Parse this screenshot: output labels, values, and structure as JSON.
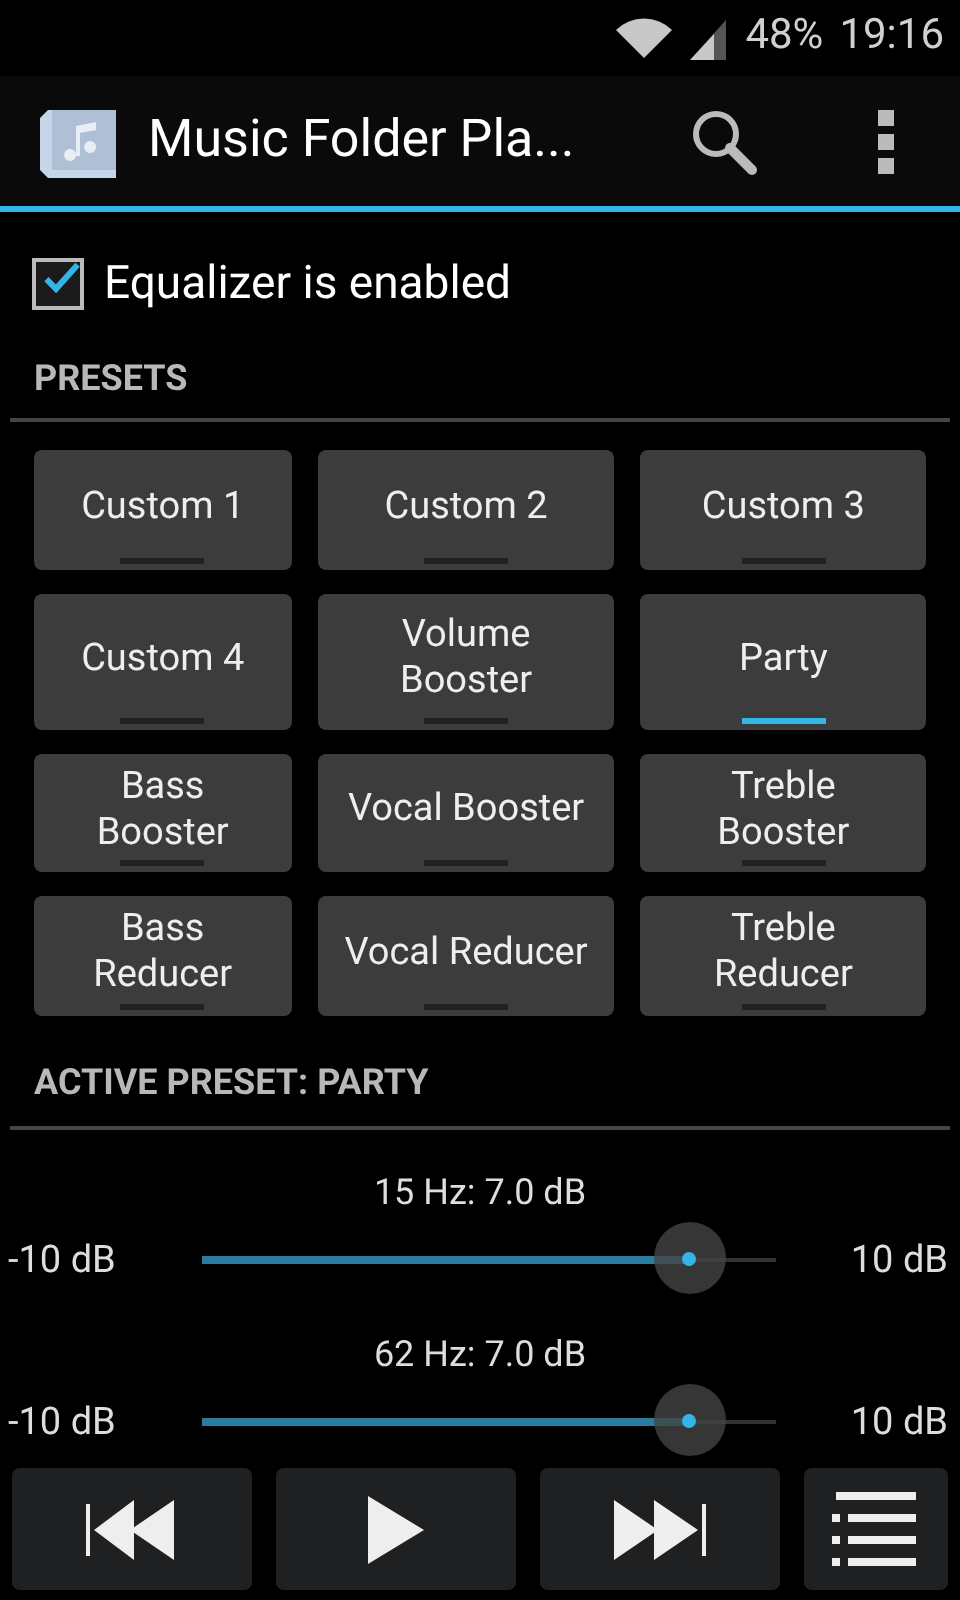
{
  "status_bar": {
    "battery": "48%",
    "time": "19:16"
  },
  "action_bar": {
    "title": "Music Folder Pla..."
  },
  "equalizer_toggle": {
    "label": "Equalizer is enabled",
    "checked": true
  },
  "presets_header": "PRESETS",
  "preset_rows": [
    {
      "presets": [
        {
          "label": "Custom 1",
          "selected": false
        },
        {
          "label": "Custom 2",
          "selected": false
        },
        {
          "label": "Custom 3",
          "selected": false
        }
      ]
    },
    {
      "presets": [
        {
          "label": "Custom 4",
          "selected": false
        },
        {
          "label": "Volume Booster",
          "selected": false
        },
        {
          "label": "Party",
          "selected": true
        }
      ]
    },
    {
      "presets": [
        {
          "label": "Bass Booster",
          "selected": false
        },
        {
          "label": "Vocal Booster",
          "selected": false
        },
        {
          "label": "Treble Booster",
          "selected": false
        }
      ]
    },
    {
      "presets": [
        {
          "label": "Bass Reducer",
          "selected": false
        },
        {
          "label": "Vocal Reducer",
          "selected": false
        },
        {
          "label": "Treble Reducer",
          "selected": false
        }
      ]
    }
  ],
  "active_preset_header": "ACTIVE PRESET: PARTY",
  "bands": [
    {
      "label": "15 Hz: 7.0 dB",
      "min": "-10 dB",
      "max": "10 dB",
      "level": 0.85
    },
    {
      "label": "62 Hz: 7.0 dB",
      "min": "-10 dB",
      "max": "10 dB",
      "level": 0.85
    }
  ]
}
